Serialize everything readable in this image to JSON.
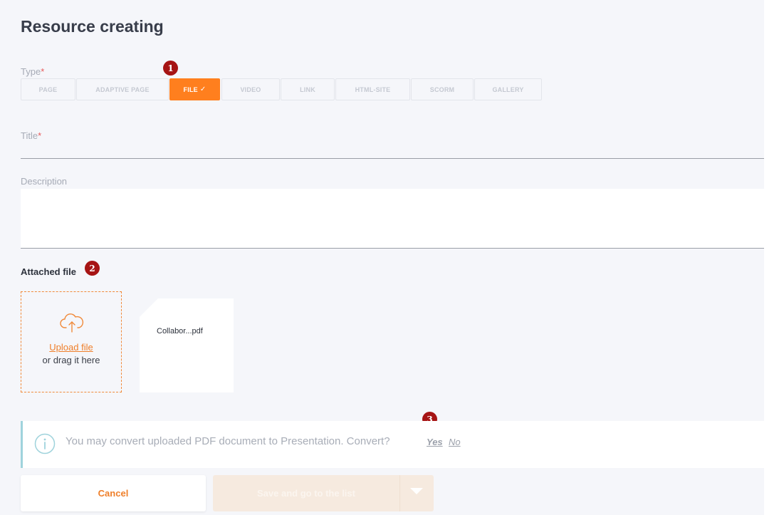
{
  "page": {
    "title": "Resource creating"
  },
  "type_field": {
    "label": "Type",
    "required_mark": "*",
    "options": [
      {
        "label": "PAGE",
        "active": false
      },
      {
        "label": "ADAPTIVE PAGE",
        "active": false
      },
      {
        "label": "FILE",
        "active": true
      },
      {
        "label": "VIDEO",
        "active": false
      },
      {
        "label": "LINK",
        "active": false
      },
      {
        "label": "HTML-SITE",
        "active": false
      },
      {
        "label": "SCORM",
        "active": false
      },
      {
        "label": "GALLERY",
        "active": false
      }
    ],
    "selected_check": "✓"
  },
  "title_field": {
    "label": "Title",
    "required_mark": "*",
    "value": ""
  },
  "description_field": {
    "label": "Description",
    "value": ""
  },
  "attached_file": {
    "label": "Attached file",
    "upload_link": "Upload file",
    "upload_hint": "or drag it here",
    "files": [
      {
        "name": "Collabor...pdf"
      }
    ]
  },
  "notice": {
    "text": "You may convert uploaded PDF document to Presentation. Convert?",
    "yes": "Yes",
    "no": "No"
  },
  "footer": {
    "cancel_label": "Cancel",
    "save_label": "Save and go to the list"
  },
  "badges": [
    "1",
    "2",
    "3"
  ],
  "colors": {
    "accent": "#ff7f1e",
    "badge": "#a61414",
    "info": "#9fd3dc",
    "background": "#f5f6fa"
  },
  "icons": {
    "upload": "cloud-upload-icon",
    "info": "info-circle-icon",
    "dropdown": "caret-down-icon"
  }
}
